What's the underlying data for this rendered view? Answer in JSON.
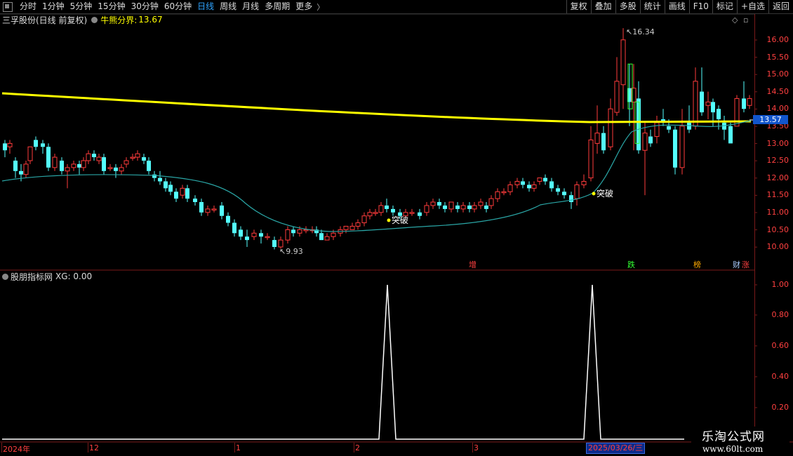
{
  "toolbar": {
    "periods": [
      {
        "label": "分时",
        "active": false
      },
      {
        "label": "1分钟",
        "active": false
      },
      {
        "label": "5分钟",
        "active": false
      },
      {
        "label": "15分钟",
        "active": false
      },
      {
        "label": "30分钟",
        "active": false
      },
      {
        "label": "60分钟",
        "active": false
      },
      {
        "label": "日线",
        "active": true
      },
      {
        "label": "周线",
        "active": false
      },
      {
        "label": "月线",
        "active": false
      },
      {
        "label": "多周期",
        "active": false
      },
      {
        "label": "更多",
        "active": false
      }
    ],
    "right_items": [
      "复权",
      "叠加",
      "多股",
      "统计",
      "画线",
      "F10",
      "标记",
      "+自选",
      "返回"
    ]
  },
  "main_panel": {
    "stock_name": "三孚股份(日线 前复权)",
    "indicator_name": "牛熊分界:",
    "indicator_value": "13.67",
    "current_price": "13.57",
    "high_label": "16.34",
    "low_label": "9.93",
    "signal_label": "突破",
    "event_labels": [
      "增",
      "跌",
      "榜",
      "财",
      "涨"
    ],
    "y_ticks": [
      "16.00",
      "15.50",
      "15.00",
      "14.50",
      "14.00",
      "13.50",
      "13.00",
      "12.50",
      "12.00",
      "11.50",
      "11.00",
      "10.50",
      "10.00"
    ]
  },
  "sub_panel": {
    "name": "股朋指标网",
    "xg_label": "XG: 0.00",
    "y_ticks": [
      "1.00",
      "0.80",
      "0.60",
      "0.40",
      "0.20"
    ]
  },
  "date_axis": {
    "labels": [
      "2024年",
      "12",
      "1",
      "2",
      "3"
    ],
    "cursor_date": "2025/03/26/三"
  },
  "watermark": {
    "title": "乐淘公式网",
    "url": "www.60lt.com"
  },
  "colors": {
    "up": "#ff3b3b",
    "down": "#54ffff",
    "bull_bear_line": "#ffff00",
    "ma_line": "#2aa6a6",
    "xg_line": "#ffffff",
    "axis": "#ff4040"
  },
  "chart_data": {
    "type": "line",
    "description_series": [
      {
        "name": "牛熊分界",
        "values_start": 14.45,
        "values_end": 13.67
      }
    ],
    "xg_signal_positions": [
      "2",
      "3"
    ],
    "ylim_main": [
      9.8,
      16.5
    ],
    "ylim_sub": [
      0,
      1.0
    ]
  }
}
